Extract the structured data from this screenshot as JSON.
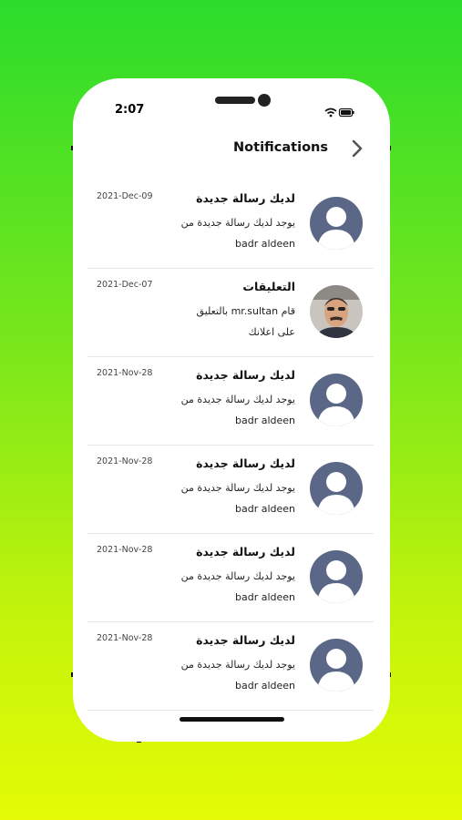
{
  "status_bar": {
    "time": "2:07"
  },
  "header": {
    "title": "Notifications",
    "back_icon": "chevron-right-icon"
  },
  "colors": {
    "avatar_placeholder": "#5b6786",
    "background_top": "#2bdc2c",
    "background_bottom": "#e4fb05"
  },
  "notifications": [
    {
      "date": "2021-Dec-09",
      "title": "لديك رسالة جديدة",
      "line1": "يوجد لديك رسالة جديدة من",
      "line2": "badr aldeen",
      "avatar": "default-avatar"
    },
    {
      "date": "2021-Dec-07",
      "title": "التعليقات",
      "line1": "قام mr.sultan بالتعليق",
      "line2": "على اعلانك",
      "avatar": "user-photo"
    },
    {
      "date": "2021-Nov-28",
      "title": "لديك رسالة جديدة",
      "line1": "يوجد لديك رسالة جديدة من",
      "line2": "badr aldeen",
      "avatar": "default-avatar"
    },
    {
      "date": "2021-Nov-28",
      "title": "لديك رسالة جديدة",
      "line1": "يوجد لديك رسالة جديدة من",
      "line2": "badr aldeen",
      "avatar": "default-avatar"
    },
    {
      "date": "2021-Nov-28",
      "title": "لديك رسالة جديدة",
      "line1": "يوجد لديك رسالة جديدة من",
      "line2": "badr aldeen",
      "avatar": "default-avatar"
    },
    {
      "date": "2021-Nov-28",
      "title": "لديك رسالة جديدة",
      "line1": "يوجد لديك رسالة جديدة من",
      "line2": "badr aldeen",
      "avatar": "default-avatar"
    }
  ]
}
